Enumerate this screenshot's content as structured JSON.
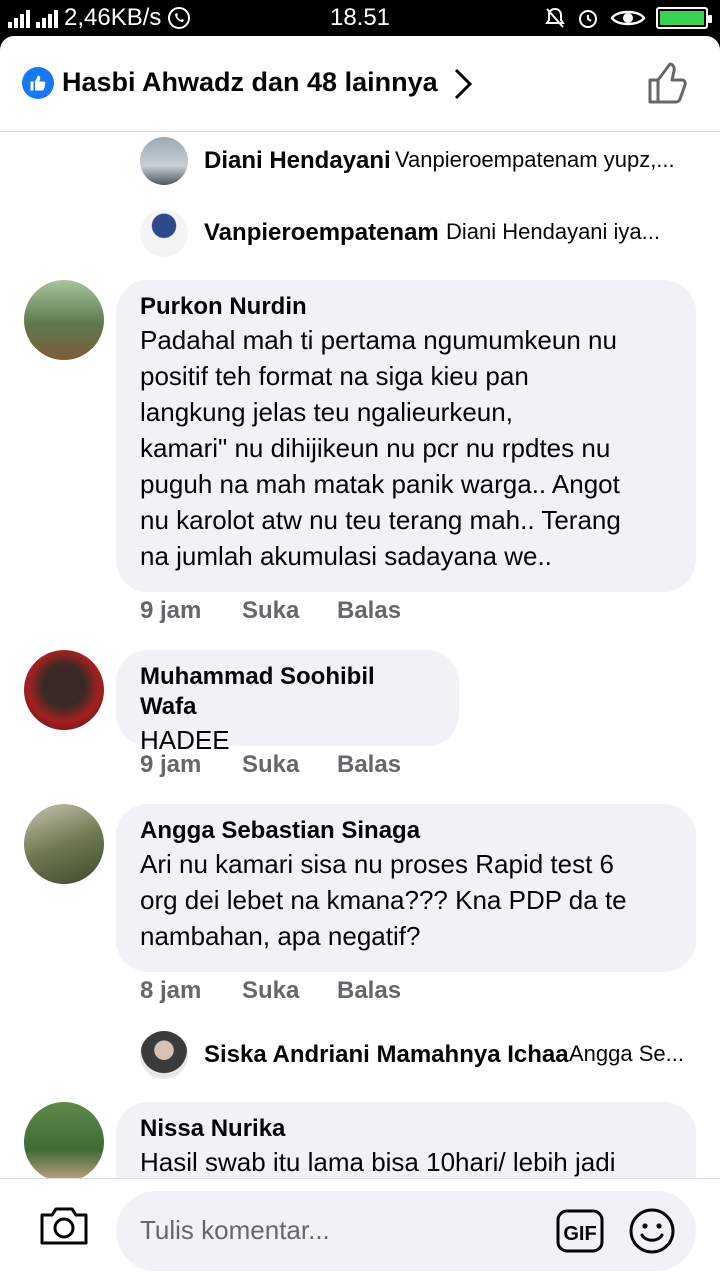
{
  "status_bar": {
    "network_speed": "2,46KB/s",
    "time": "18.51",
    "battery_level": 1.0,
    "icons": [
      "signal-icon",
      "signal-icon",
      "whatsapp-icon",
      "mute-icon",
      "alarm-icon",
      "eye-icon",
      "battery-charging-icon"
    ]
  },
  "header": {
    "title": "Hasbi Ahwadz dan 48 lainnya",
    "accent": "#1877f2"
  },
  "replies_top": [
    {
      "name": "Diani Hendayani",
      "text": "Vanpieroempatenam yupz,..."
    },
    {
      "name": "Vanpieroempatenam",
      "text": "Diani Hendayani iya..."
    }
  ],
  "comments": [
    {
      "name": "Purkon Nurdin",
      "text": "Padahal mah ti pertama ngumumkeun nu\npositif teh format na siga kieu pan\nlangkung jelas teu ngalieurkeun,\n kamari\" nu dihijikeun nu pcr nu rpdtes nu\npuguh na mah matak panik warga.. Angot\nnu karolot atw nu teu terang mah..  Terang\nna jumlah akumulasi sadayana we..",
      "time": "9 jam",
      "like": "Suka",
      "reply": "Balas"
    },
    {
      "name": "Muhammad Soohibil Wafa",
      "text": "HADEE",
      "time": "9 jam",
      "like": "Suka",
      "reply": "Balas"
    },
    {
      "name": "Angga Sebastian Sinaga",
      "text": "Ari nu kamari sisa nu proses Rapid test 6\norg dei lebet na kmana??? Kna PDP da te\nnambahan, apa negatif?",
      "time": "8 jam",
      "like": "Suka",
      "reply": "Balas"
    },
    {
      "name": "Nissa Nurika",
      "text": "Hasil swab itu lama bisa 10hari/ lebih jadi"
    }
  ],
  "reply_mid": {
    "name": "Siska Andriani Mamahnya Ichaa",
    "text": "Angga Se..."
  },
  "composer": {
    "placeholder": "Tulis komentar...",
    "gif_label": "GIF"
  }
}
